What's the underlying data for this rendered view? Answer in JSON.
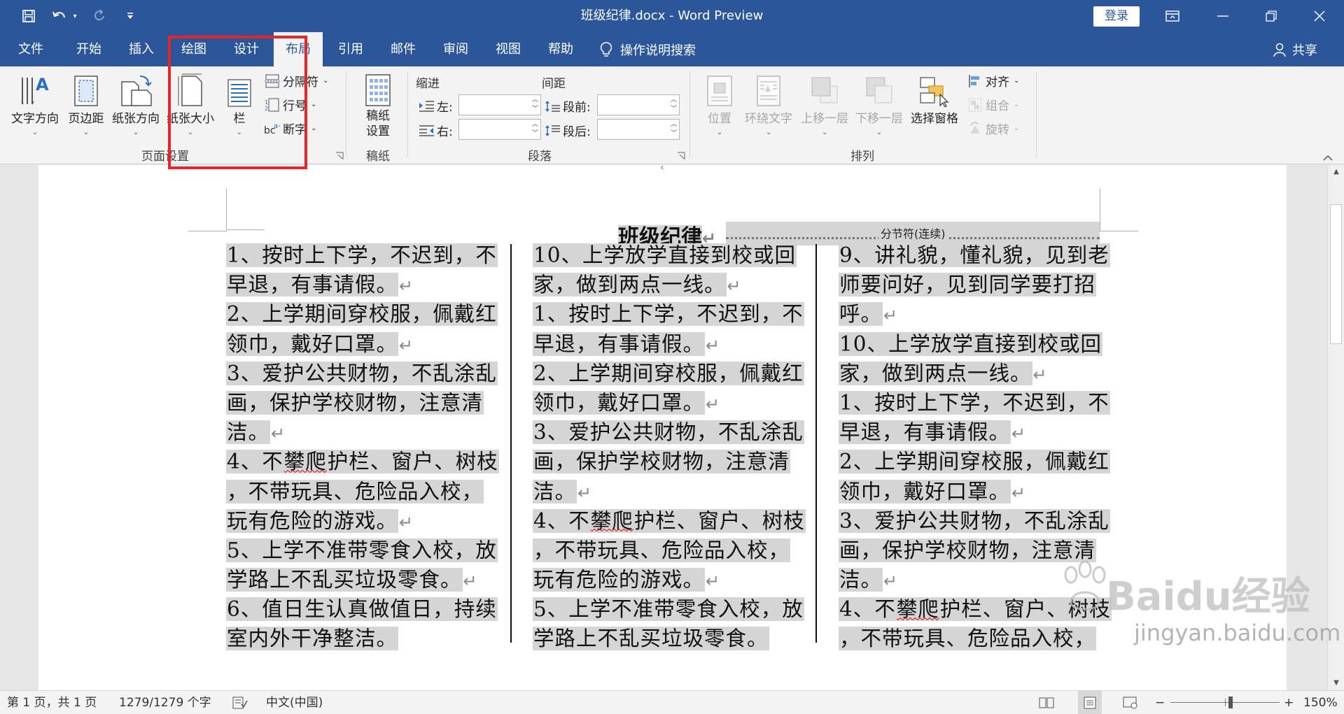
{
  "app": {
    "title": "班级纪律.docx  -  Word Preview",
    "login_label": "登录"
  },
  "tabs": [
    {
      "label": "文件"
    },
    {
      "label": "开始"
    },
    {
      "label": "插入"
    },
    {
      "label": "绘图"
    },
    {
      "label": "设计"
    },
    {
      "label": "布局"
    },
    {
      "label": "引用"
    },
    {
      "label": "邮件"
    },
    {
      "label": "审阅"
    },
    {
      "label": "视图"
    },
    {
      "label": "帮助"
    }
  ],
  "tell_me": "操作说明搜索",
  "share": "共享",
  "ribbon": {
    "page_setup": {
      "text_direction": "文字方向",
      "margins": "页边距",
      "orientation": "纸张方向",
      "size": "纸张大小",
      "columns": "栏",
      "breaks": "分隔符",
      "line_numbers": "行号",
      "hyphenation": "断字",
      "group_label": "页面设置"
    },
    "manuscript": {
      "settings": "稿纸设置",
      "group_label": "稿纸"
    },
    "paragraph": {
      "indent_label": "缩进",
      "spacing_label": "间距",
      "left": "左:",
      "right": "右:",
      "before": "段前:",
      "after": "段后:",
      "group_label": "段落"
    },
    "arrange": {
      "position": "位置",
      "wrap_text": "环绕文字",
      "bring_forward": "上移一层",
      "send_backward": "下移一层",
      "selection_pane": "选择窗格",
      "align": "对齐",
      "group": "组合",
      "rotate": "旋转",
      "group_label": "排列"
    }
  },
  "document": {
    "heading": "班级纪律",
    "section_break": "分节符(连续)",
    "columns": [
      [
        "1、按时上下学，不迟到，不",
        "早退，有事请假。",
        "2、上学期间穿校服，佩戴红",
        "领巾，戴好口罩。",
        "3、爱护公共财物，不乱涂乱",
        "画，保护学校财物，注意清",
        "洁。",
        "4、不攀爬护栏、窗户、树枝",
        "，不带玩具、危险品入校，",
        "玩有危险的游戏。",
        "5、上学不准带零食入校，放",
        "学路上不乱买垃圾零食。",
        "6、值日生认真做值日，持续",
        "室内外干净整洁。"
      ],
      [
        "10、上学放学直接到校或回",
        "家，做到两点一线。",
        "1、按时上下学，不迟到，不",
        "早退，有事请假。",
        "2、上学期间穿校服，佩戴红",
        "领巾，戴好口罩。",
        "3、爱护公共财物，不乱涂乱",
        "画，保护学校财物，注意清",
        "洁。",
        "4、不攀爬护栏、窗户、树枝",
        "，不带玩具、危险品入校，",
        "玩有危险的游戏。",
        "5、上学不准带零食入校，放",
        "学路上不乱买垃圾零食。"
      ],
      [
        "9、讲礼貌，懂礼貌，见到老",
        "师要问好，见到同学要打招",
        "呼。",
        "10、上学放学直接到校或回",
        "家，做到两点一线。",
        "1、按时上下学，不迟到，不",
        "早退，有事请假。",
        "2、上学期间穿校服，佩戴红",
        "领巾，戴好口罩。",
        "3、爱护公共财物，不乱涂乱",
        "画，保护学校财物，注意清",
        "洁。",
        "4、不攀爬护栏、窗户、树枝",
        "，不带玩具、危险品入校，"
      ]
    ]
  },
  "status": {
    "page": "第 1 页，共 1 页",
    "words": "1279/1279 个字",
    "language": "中文(中国)",
    "zoom": "150%"
  },
  "watermark": {
    "brand": "Baidu经验",
    "url": "jingyan.baidu.com"
  },
  "colors": {
    "brand_blue": "#2b579a",
    "annotation_red": "#e8252a",
    "selection_gray": "#d5d5d5"
  }
}
